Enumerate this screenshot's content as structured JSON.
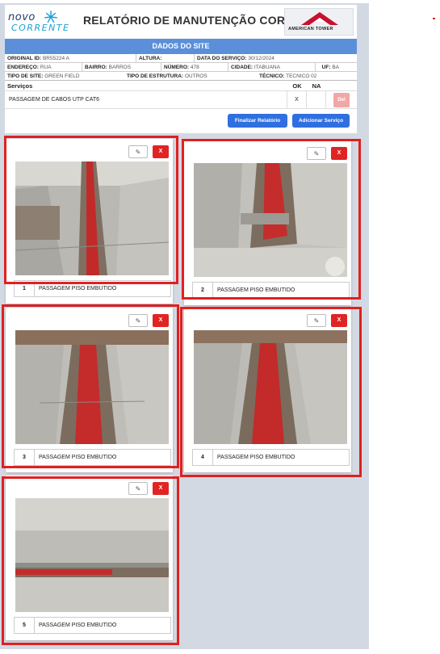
{
  "header": {
    "logo_left_line1": "novo",
    "logo_left_line2": "CORRENTE",
    "title": "RELATÓRIO DE MANUTENÇÃO CORRETIVA",
    "logo_right_text": "AMERICAN TOWER"
  },
  "section_title": "DADOS DO SITE",
  "site": {
    "original_id_label": "ORIGINAL ID:",
    "original_id": "BR55224 A",
    "altura_label": "ALTURA:",
    "altura": "",
    "data_servico_label": "DATA DO SERVIÇO:",
    "data_servico": "30/12/2024",
    "endereco_label": "ENDEREÇO:",
    "endereco": "RUA",
    "bairro_label": "BAIRRO:",
    "bairro": "BARROS",
    "numero_label": "NÚMERO:",
    "numero": "478",
    "cidade_label": "CIDADE:",
    "cidade": "ITABUANA",
    "uf_label": "UF:",
    "uf": "BA",
    "tipo_site_label": "TIPO DE SITE:",
    "tipo_site": "GREEN FIELD",
    "tipo_estrutura_label": "TIPO DE ESTRUTURA:",
    "tipo_estrutura": "OUTROS",
    "tecnico_label": "TÉCNICO:",
    "tecnico": "TECNICO 02"
  },
  "services": {
    "col_servicos": "Serviços",
    "col_ok": "OK",
    "col_na": "NA",
    "rows": [
      {
        "name": "PASSAGEM DE CABOS UTP CAT6",
        "ok": "X",
        "na": "",
        "del_label": "Del"
      }
    ]
  },
  "actions": {
    "finalizar": "Finalizar Relatório",
    "adicionar": "Adicionar Serviço"
  },
  "photos": [
    {
      "num": "1",
      "desc": "PASSAGEM PISO EMBUTIDO",
      "delete_label": "X"
    },
    {
      "num": "2",
      "desc": "PASSAGEM PISO EMBUTIDO",
      "delete_label": "X"
    },
    {
      "num": "3",
      "desc": "PASSAGEM PISO EMBUTIDO",
      "delete_label": "X"
    },
    {
      "num": "4",
      "desc": "PASSAGEM PISO EMBUTIDO",
      "delete_label": "X"
    },
    {
      "num": "5",
      "desc": "PASSAGEM PISO EMBUTIDO",
      "delete_label": "X"
    }
  ],
  "colors": {
    "band": "#5b8fd9",
    "primary_button": "#2f6fe0",
    "delete_button": "#e02424",
    "highlight_frame": "#e02020"
  }
}
